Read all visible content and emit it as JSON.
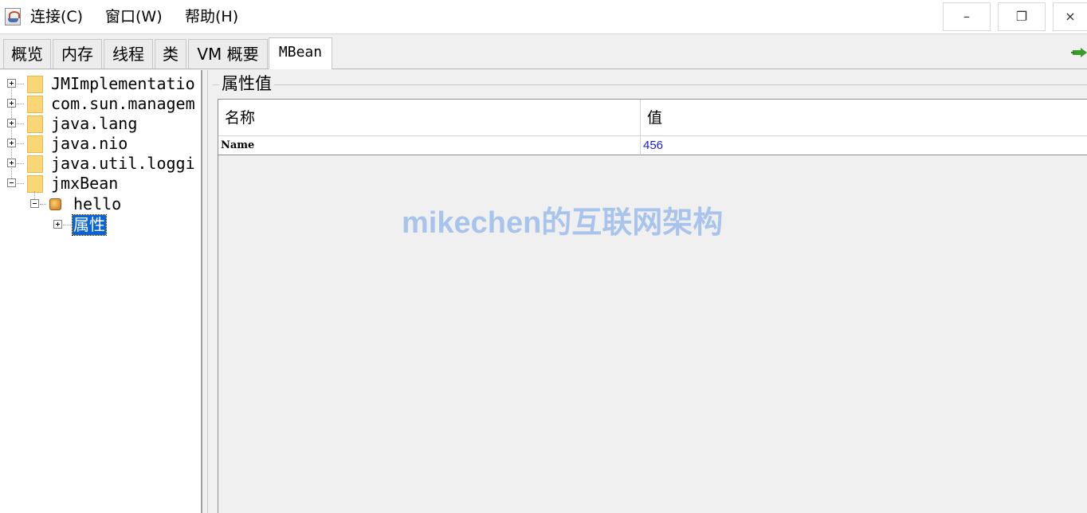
{
  "menubar": {
    "items": [
      "连接(C)",
      "窗口(W)",
      "帮助(H)"
    ],
    "window_buttons": {
      "minimize": "–",
      "restore": "❐",
      "close": "×"
    }
  },
  "tabs": [
    {
      "label": "概览",
      "active": false
    },
    {
      "label": "内存",
      "active": false
    },
    {
      "label": "线程",
      "active": false
    },
    {
      "label": "类",
      "active": false
    },
    {
      "label": "VM 概要",
      "active": false
    },
    {
      "label": "MBean",
      "active": true
    }
  ],
  "tree": {
    "nodes": [
      {
        "label": "JMImplementatio",
        "expanded": false
      },
      {
        "label": "com.sun.managem",
        "expanded": false
      },
      {
        "label": "java.lang",
        "expanded": false
      },
      {
        "label": "java.nio",
        "expanded": false
      },
      {
        "label": "java.util.loggi",
        "expanded": false
      },
      {
        "label": "jmxBean",
        "expanded": true
      }
    ],
    "bean": {
      "label": "hello",
      "icon": "mbean-icon"
    },
    "attributes": {
      "label": "属性",
      "selected": true
    }
  },
  "attributes_panel": {
    "title": "属性值",
    "columns": [
      "名称",
      "值"
    ],
    "rows": [
      {
        "name": "Name",
        "value": "456"
      }
    ]
  },
  "watermark": "mikechen的互联网架构",
  "colors": {
    "selection": "#0a64d8",
    "value_text": "#1b1bd6",
    "watermark": "#a9c4ec",
    "folder": "#fbd676"
  }
}
